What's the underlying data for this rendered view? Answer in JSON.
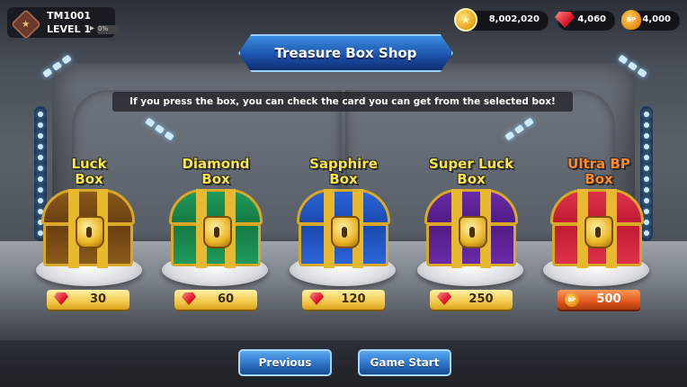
{
  "player": {
    "name": "TM1001",
    "level_label": "LEVEL 1",
    "xp_percent_label": "0%",
    "xp_fraction": 0.0
  },
  "currencies": {
    "gold": "8,002,020",
    "gems": "4,060",
    "bp": "4,000",
    "bp_icon_text": "BP"
  },
  "shop": {
    "title": "Treasure Box Shop",
    "info": "If you press the box, you can check the card you can get from the selected box!"
  },
  "boxes": [
    {
      "name_line1": "Luck",
      "name_line2": "Box",
      "price": "30",
      "currency": "gem",
      "color_lid": "#8a5a1a",
      "color_body": "#6b3f10",
      "label_color": "#f7e54a"
    },
    {
      "name_line1": "Diamond",
      "name_line2": "Box",
      "price": "60",
      "currency": "gem",
      "color_lid": "#1f9a5a",
      "color_body": "#157a45",
      "label_color": "#f7e54a"
    },
    {
      "name_line1": "Sapphire",
      "name_line2": "Box",
      "price": "120",
      "currency": "gem",
      "color_lid": "#2a64d8",
      "color_body": "#1b4ab0",
      "label_color": "#f7e54a"
    },
    {
      "name_line1": "Super Luck",
      "name_line2": "Box",
      "price": "250",
      "currency": "gem",
      "color_lid": "#6a2aa8",
      "color_body": "#521c86",
      "label_color": "#f7e54a"
    },
    {
      "name_line1": "Ultra BP",
      "name_line2": "Box",
      "price": "500",
      "currency": "bp",
      "color_lid": "#e0304a",
      "color_body": "#c01c34",
      "label_color": "#ff8a2a"
    }
  ],
  "buttons": {
    "previous": "Previous",
    "game_start": "Game Start"
  }
}
